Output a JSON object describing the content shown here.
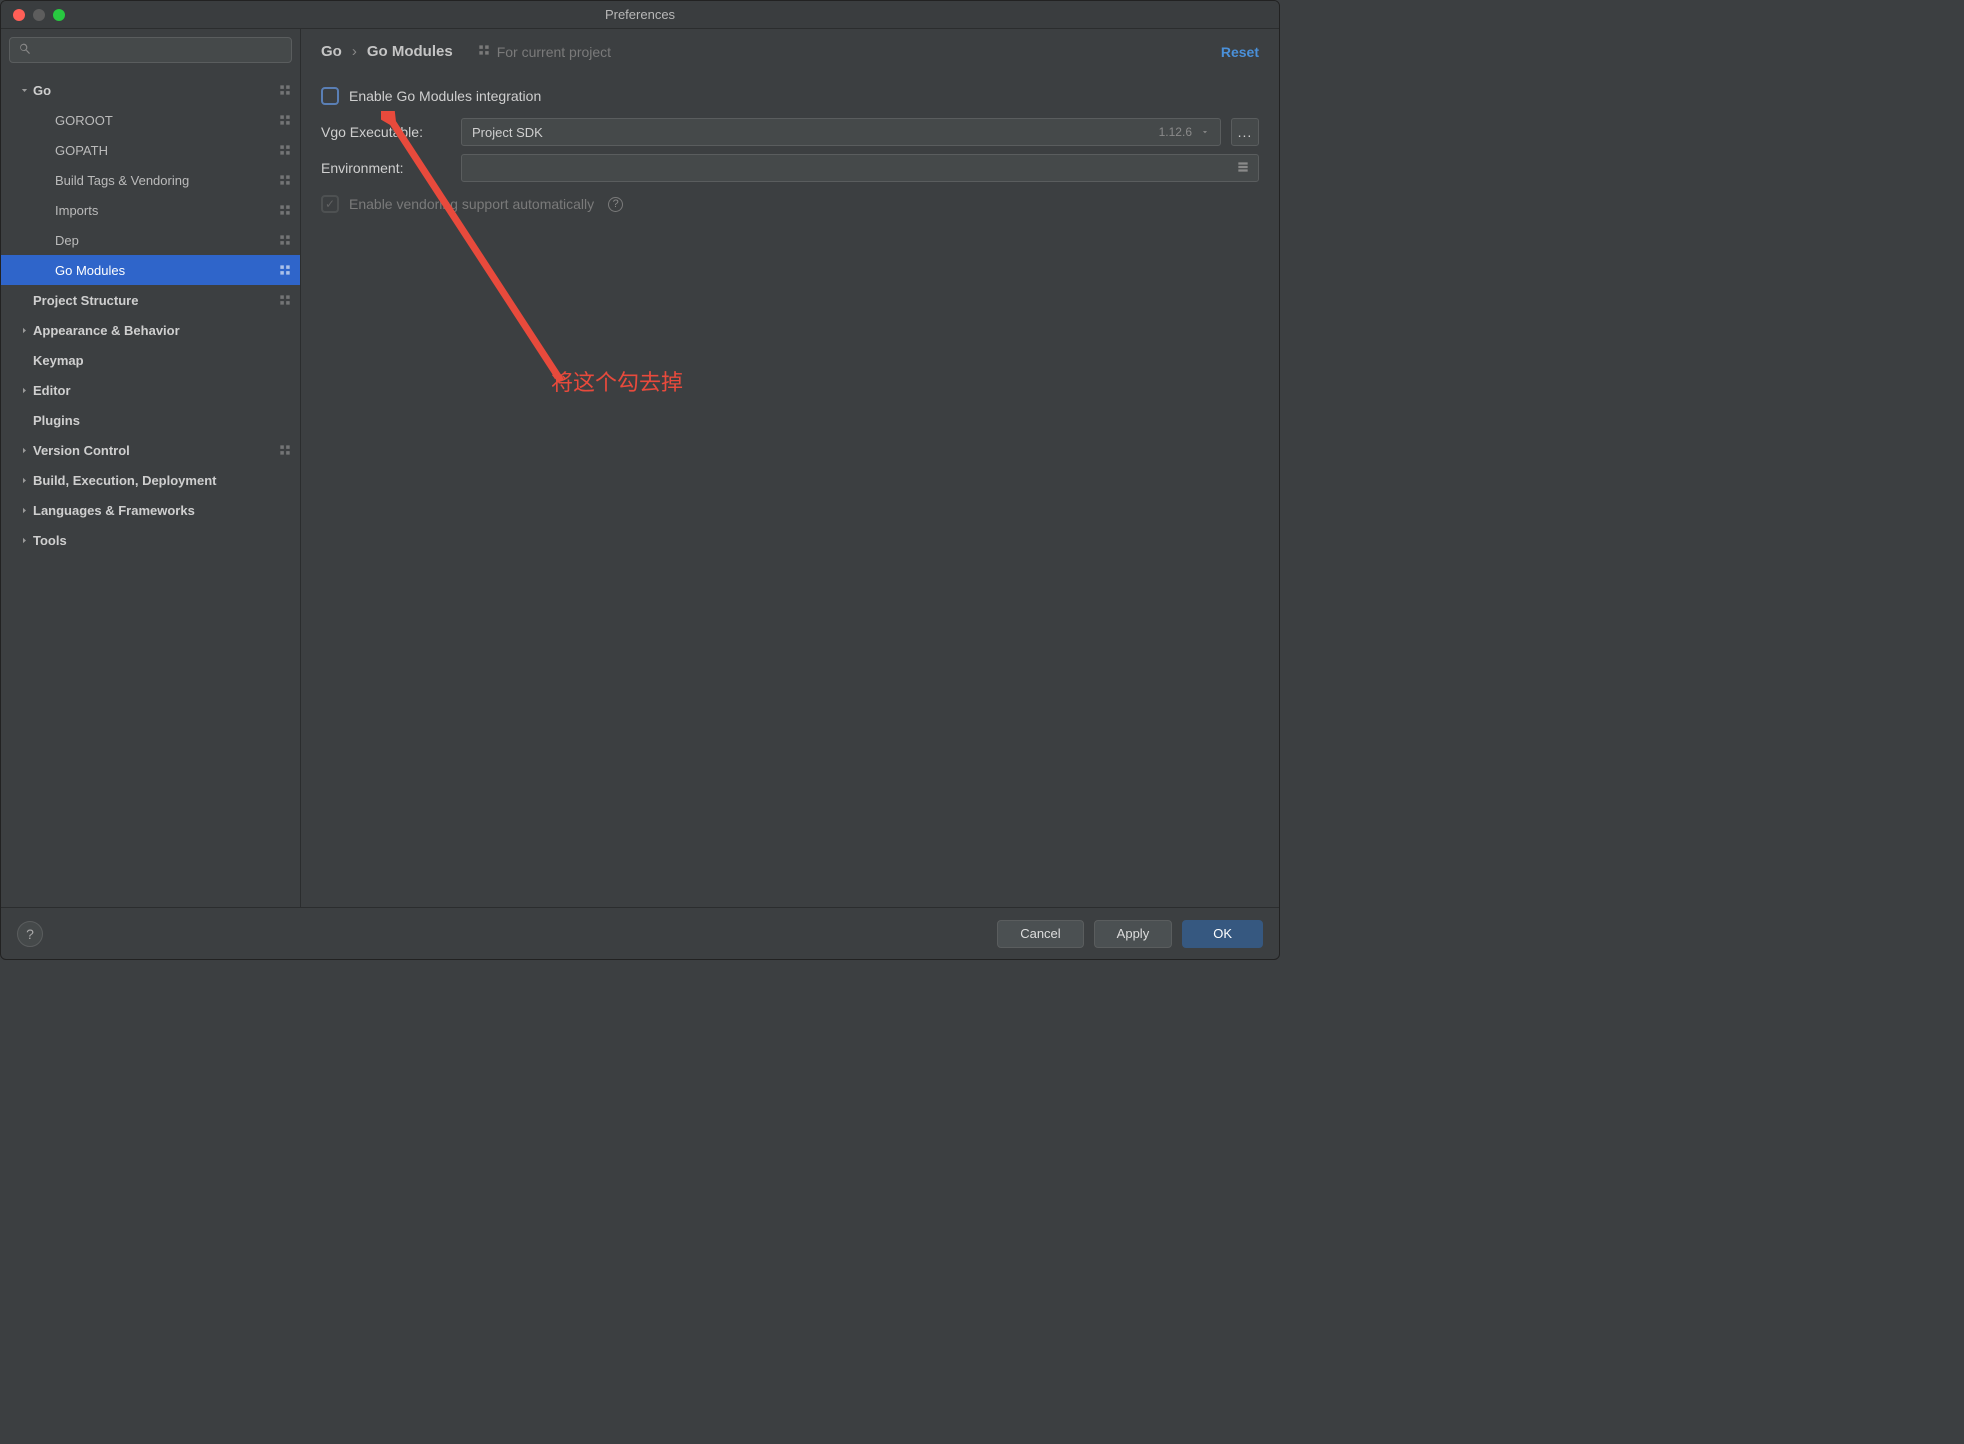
{
  "window": {
    "title": "Preferences"
  },
  "search": {
    "placeholder": ""
  },
  "header": {
    "breadcrumb_root": "Go",
    "breadcrumb_leaf": "Go Modules",
    "scope_note": "For current project",
    "reset": "Reset"
  },
  "sidebar": {
    "items": [
      {
        "label": "Go",
        "level": 0,
        "bold": true,
        "disclosure": "down",
        "scope": true
      },
      {
        "label": "GOROOT",
        "level": 1,
        "scope": true
      },
      {
        "label": "GOPATH",
        "level": 1,
        "scope": true
      },
      {
        "label": "Build Tags & Vendoring",
        "level": 1,
        "scope": true
      },
      {
        "label": "Imports",
        "level": 1,
        "scope": true
      },
      {
        "label": "Dep",
        "level": 1,
        "scope": true
      },
      {
        "label": "Go Modules",
        "level": 1,
        "scope": true,
        "selected": true
      },
      {
        "label": "Project Structure",
        "level": 0,
        "bold": true,
        "scope": true
      },
      {
        "label": "Appearance & Behavior",
        "level": 0,
        "bold": true,
        "disclosure": "right"
      },
      {
        "label": "Keymap",
        "level": 0,
        "bold": true
      },
      {
        "label": "Editor",
        "level": 0,
        "bold": true,
        "disclosure": "right"
      },
      {
        "label": "Plugins",
        "level": 0,
        "bold": true
      },
      {
        "label": "Version Control",
        "level": 0,
        "bold": true,
        "disclosure": "right",
        "scope": true
      },
      {
        "label": "Build, Execution, Deployment",
        "level": 0,
        "bold": true,
        "disclosure": "right"
      },
      {
        "label": "Languages & Frameworks",
        "level": 0,
        "bold": true,
        "disclosure": "right"
      },
      {
        "label": "Tools",
        "level": 0,
        "bold": true,
        "disclosure": "right"
      }
    ]
  },
  "panel": {
    "enable_modules_label": "Enable Go Modules integration",
    "vgo_label": "Vgo Executable:",
    "vgo_selected": "Project SDK",
    "vgo_version": "1.12.6",
    "browse_label": "...",
    "env_label": "Environment:",
    "env_value": "",
    "vendoring_label": "Enable vendoring support automatically"
  },
  "annotation": {
    "text": "将这个勾去掉"
  },
  "footer": {
    "cancel": "Cancel",
    "apply": "Apply",
    "ok": "OK"
  },
  "colors": {
    "accent": "#2f65ca",
    "annotation": "#e84a3c"
  }
}
